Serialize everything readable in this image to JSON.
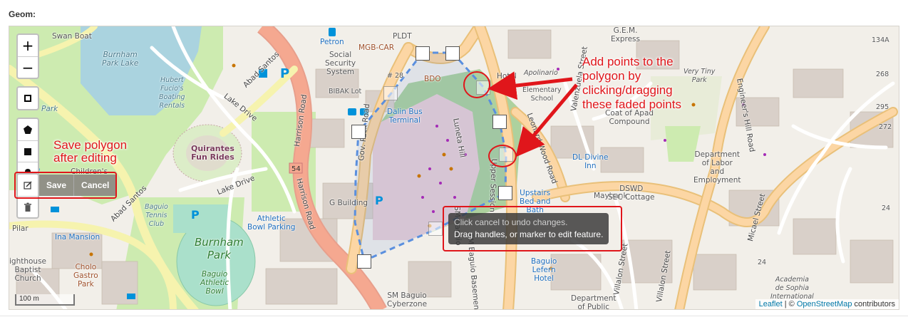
{
  "form": {
    "field_label": "Geom:"
  },
  "map": {
    "zoom_in": "+",
    "zoom_out": "−",
    "tools": {
      "edit_actions": {
        "save": "Save",
        "cancel": "Cancel"
      }
    },
    "tooltip": {
      "line1": "Click cancel to undo changes.",
      "line2": "Drag handles, or marker to edit feature."
    },
    "scale": "100 m",
    "attribution": {
      "leaflet": "Leaflet",
      "separator": " | © ",
      "osm": "OpenStreetMap",
      "suffix": " contributors"
    },
    "labels": {
      "swan_boat": "Swan Boat",
      "burnham_park_lake": "Burnham\nPark Lake",
      "hubert": "Hubert\nFucio's\nBoating\nRentals",
      "park": "Park",
      "quirantes": "Quirantes\nFun Rides",
      "childrens": "Children's",
      "lake_drive_1": "Lake Drive",
      "lake_drive_2": "Lake Drive",
      "abad_santos_1": "Abad Santos",
      "abad_santos_2": "Abad Santos",
      "harrison_1": "Harrison Road",
      "harrison_2": "Harrison Road",
      "route_54": "54",
      "petron": "Petron",
      "mgbcar": "MGB-CAR",
      "pldt": "PLDT",
      "social": "Social\nSecurity\nSystem",
      "bibak": "BIBAK Lot",
      "no28": "# 28",
      "bdo": "BDO",
      "dalin": "Dalin Bus\nTerminal",
      "hotel": "Hotel",
      "apolinario": "Apolinario",
      "elementary": "Elementary\nSchool",
      "gem": "G.E.M.\nExpress",
      "very_tiny": "Very Tiny\nPark",
      "coa": "Coat of Apad\nCompound",
      "luneta_hill": "Luneta Hill",
      "leonard_wood": "Leonard Wood Road",
      "valenzuela": "Valenzuela Street",
      "engineers": "Engineer's Hill Road",
      "dl_divine": "DL Divine\nInn",
      "dept_labor": "Department\nof Labor\nand\nEmployment",
      "maybank": "Maybank",
      "dswd": "DSWD\nSEC Cottage",
      "upstairs": "Upstairs\nBed and\nBath",
      "gov_pack": "Gov. Pack Road",
      "g_building": "G Building",
      "upper_session": "Upper Session",
      "sm_baguio": "SM Baguio",
      "sm_basement": "SM Baguio Basement Parking",
      "baguio_tennis": "Baguio\nTennis\nClub",
      "athletic_bowl_parking": "Athletic\nBowl Parking",
      "burnham_park": "Burnham\nPark",
      "baguio_athletic": "Baguio\nAthletic\nBowl",
      "pilar": "Pilar",
      "ina_mansion": "Ina Mansion",
      "lighthouse": "ighthouse\nBaptist\nChurch",
      "cholo": "Cholo\nGastro\nPark",
      "sm_cyberzone": "SM Baguio\nCyberzone",
      "baguio_lefern": "Baguio\nLefern\nHotel",
      "dept_public": "Department\nof Public",
      "villalon_1": "Villalon Street",
      "villalon_2": "Villalon Street",
      "micael": "Micael Street",
      "academia": "Academia\nde Sophia\nInternational",
      "numbers": [
        "134A",
        "268",
        "295",
        "272",
        "24",
        "24"
      ]
    }
  },
  "annotations": {
    "add_points": "Add points to the\npolygon by\nclicking/dragging\nthese faded points",
    "save_polygon": "Save polygon\nafter editing"
  }
}
